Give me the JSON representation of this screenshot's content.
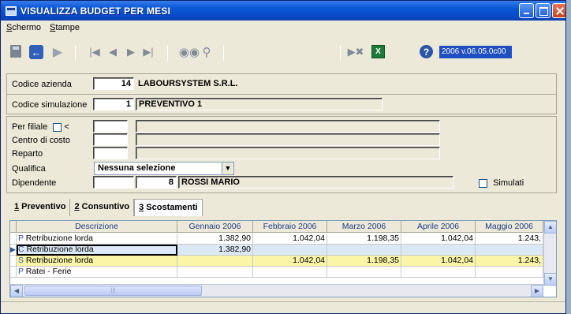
{
  "window": {
    "title": "VISUALIZZA BUDGET PER MESI"
  },
  "menu": [
    {
      "label": "Schermo",
      "accel": "S",
      "rest": "chermo"
    },
    {
      "label": "Stampe",
      "accel": "S",
      "rest": "tampe"
    }
  ],
  "toolbar": {
    "icons": [
      "save-icon",
      "back-icon",
      "forward-icon",
      "first-record-icon",
      "previous-record-icon",
      "next-record-icon",
      "last-record-icon",
      "binoculars-icon",
      "magnifier-icon",
      "skip-icon",
      "excel-icon",
      "help-icon"
    ],
    "version": "2006 v.06.05.0c00"
  },
  "header": {
    "codice_azienda_label": "Codice azienda",
    "codice_azienda_value": "14",
    "azienda_name": "LABOURSYSTEM S.R.L.",
    "codice_simulazione_label": "Codice simulazione",
    "codice_simulazione_value": "1",
    "simulazione_name": "PREVENTIVO 1"
  },
  "filters": {
    "per_filiale_label": "Per filiale",
    "per_filiale_symbol": "<",
    "per_filiale_checked": false,
    "centro_di_costo_label": "Centro di costo",
    "reparto_label": "Reparto",
    "qualifica_label": "Qualifica",
    "qualifica_value": "Nessuna selezione",
    "dipendente_label": "Dipendente",
    "dipendente_code": "8",
    "dipendente_name": "ROSSI MARIO",
    "simulati_label": "Simulati",
    "simulati_checked": false
  },
  "tabs": [
    {
      "accel": "1",
      "label": " Preventivo",
      "active": false
    },
    {
      "accel": "2",
      "label": " Consuntivo",
      "active": false
    },
    {
      "accel": "3",
      "label": " Scostamenti",
      "active": true
    }
  ],
  "grid": {
    "columns": [
      "Descrizione",
      "Gennaio 2006",
      "Febbraio 2006",
      "Marzo 2006",
      "Aprile 2006",
      "Maggio 2006"
    ],
    "rows": [
      {
        "type": "P",
        "desc": "Retribuzione lorda",
        "values": [
          "1.382,90",
          "1.042,04",
          "1.198,35",
          "1.042,04",
          "1.243,"
        ],
        "bg": "#ffffff"
      },
      {
        "type": "C",
        "desc": "Retribuzione lorda",
        "values": [
          "1.382,90",
          "",
          "",
          "",
          ""
        ],
        "bg": "#dbe9f7",
        "current": true
      },
      {
        "type": "S",
        "desc": "Retribuzione lorda",
        "values": [
          "",
          "1.042,04",
          "1.198,35",
          "1.042,04",
          "1.243,"
        ],
        "bg": "#fbf5a8"
      },
      {
        "type": "P",
        "desc": "Ratei - Ferie",
        "values": [
          "",
          "",
          "",
          "",
          ""
        ],
        "bg": "#ffffff"
      }
    ]
  }
}
